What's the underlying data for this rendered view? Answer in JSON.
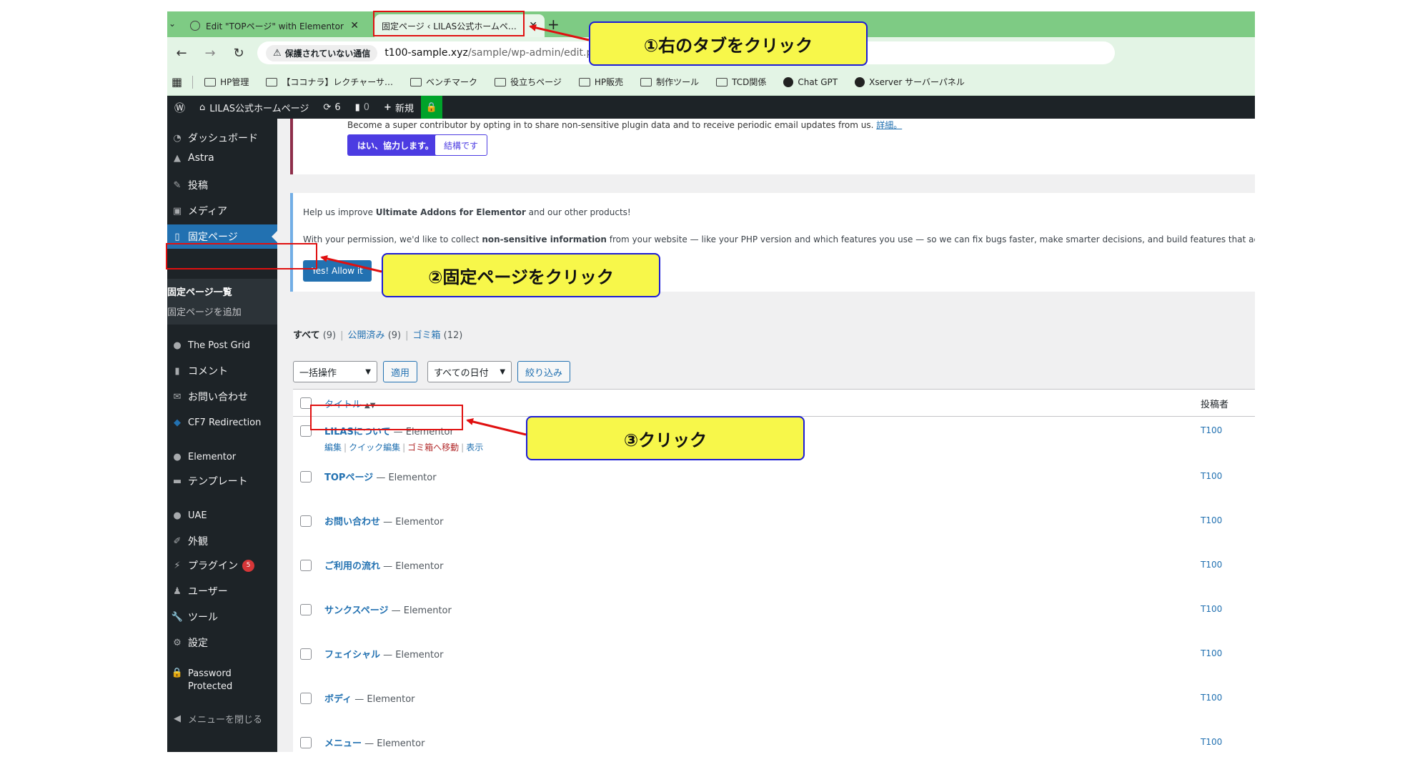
{
  "browser": {
    "tabs": [
      {
        "title": "Edit \"TOPページ\" with Elementor",
        "close": "✕"
      },
      {
        "title": "固定ページ ‹ LILAS公式ホームページ",
        "close": "✕"
      }
    ],
    "new_tab": "+",
    "security_label": "保護されていない通信",
    "url_host": "t100-sample.xyz",
    "url_path": "/sample/wp-admin/edit.php?post_type=page",
    "bookmarks": [
      "HP管理",
      "【ココナラ】レクチャーサ…",
      "ベンチマーク",
      "役立ちページ",
      "HP販売",
      "制作ツール",
      "TCD関係",
      "Chat GPT",
      "Xserver サーバーパネル"
    ]
  },
  "adminbar": {
    "site_name": "LILAS公式ホームページ",
    "updates": "6",
    "comments": "0",
    "new_label": "新規"
  },
  "sidebar": {
    "items": [
      {
        "icon": "gauge-icon",
        "label": "ダッシュボード"
      },
      {
        "icon": "astra-icon",
        "label": "Astra"
      },
      {
        "icon": "pin-icon",
        "label": "投稿"
      },
      {
        "icon": "media-icon",
        "label": "メディア"
      },
      {
        "icon": "page-icon",
        "label": "固定ページ"
      },
      {
        "icon": "grid-icon",
        "label": "The Post Grid"
      },
      {
        "icon": "comment-icon",
        "label": "コメント"
      },
      {
        "icon": "mail-icon",
        "label": "お問い合わせ"
      },
      {
        "icon": "redirect-icon",
        "label": "CF7 Redirection"
      },
      {
        "icon": "elementor-icon",
        "label": "Elementor"
      },
      {
        "icon": "folder-icon",
        "label": "テンプレート"
      },
      {
        "icon": "uae-icon",
        "label": "UAE"
      },
      {
        "icon": "brush-icon",
        "label": "外観"
      },
      {
        "icon": "plugin-icon",
        "label": "プラグイン"
      },
      {
        "icon": "user-icon",
        "label": "ユーザー"
      },
      {
        "icon": "wrench-icon",
        "label": "ツール"
      },
      {
        "icon": "settings-icon",
        "label": "設定"
      },
      {
        "icon": "lock-icon",
        "label": "Password"
      },
      {
        "icon": "collapse-icon",
        "label": "メニューを閉じる"
      }
    ],
    "password_line2": "Protected",
    "plugin_badge": "5",
    "submenu": [
      "固定ページ一覧",
      "固定ページを追加"
    ]
  },
  "notices": {
    "contrib_text": "Become a super contributor by opting in to share non-sensitive plugin data and to receive periodic email updates from us.",
    "contrib_link": "詳細。",
    "contrib_yes": "はい、協力します。",
    "contrib_no": "結構です",
    "uae_line1_a": "Help us improve ",
    "uae_line1_b": "Ultimate Addons for Elementor",
    "uae_line1_c": " and our other products!",
    "uae_line2_a": "With your permission, we'd like to collect ",
    "uae_line2_b": "non-sensitive information",
    "uae_line2_c": " from your website — like your PHP version and which features you use — so we can fix bugs faster, make smarter decisions, and build features that actu",
    "uae_allow": "Yes! Allow it"
  },
  "filters": {
    "all": "すべて",
    "all_count": "(9)",
    "published": "公開済み",
    "published_count": "(9)",
    "trash": "ゴミ箱",
    "trash_count": "(12)",
    "bulk": "一括操作",
    "apply": "適用",
    "dates": "すべての日付",
    "filter": "絞り込み"
  },
  "table": {
    "col_title": "タイトル",
    "col_author": "投稿者",
    "state": "— Elementor",
    "rows": [
      {
        "title": "LILASについて",
        "author": "T100"
      },
      {
        "title": "TOPページ",
        "author": "T100"
      },
      {
        "title": "お問い合わせ",
        "author": "T100"
      },
      {
        "title": "ご利用の流れ",
        "author": "T100"
      },
      {
        "title": "サンクスページ",
        "author": "T100"
      },
      {
        "title": "フェイシャル",
        "author": "T100"
      },
      {
        "title": "ボディ",
        "author": "T100"
      },
      {
        "title": "メニュー",
        "author": "T100"
      }
    ],
    "row_actions": [
      "編集",
      "クイック編集",
      "ゴミ箱へ移動",
      "表示"
    ]
  },
  "annotations": [
    {
      "label": "①右のタブをクリック"
    },
    {
      "label": "②固定ページをクリック"
    },
    {
      "label": "③クリック"
    }
  ],
  "colors": {
    "highlight": "#e01010",
    "callout_bg": "#f7f74a",
    "callout_border": "#1c1cd6",
    "wp_blue": "#2271b1"
  }
}
